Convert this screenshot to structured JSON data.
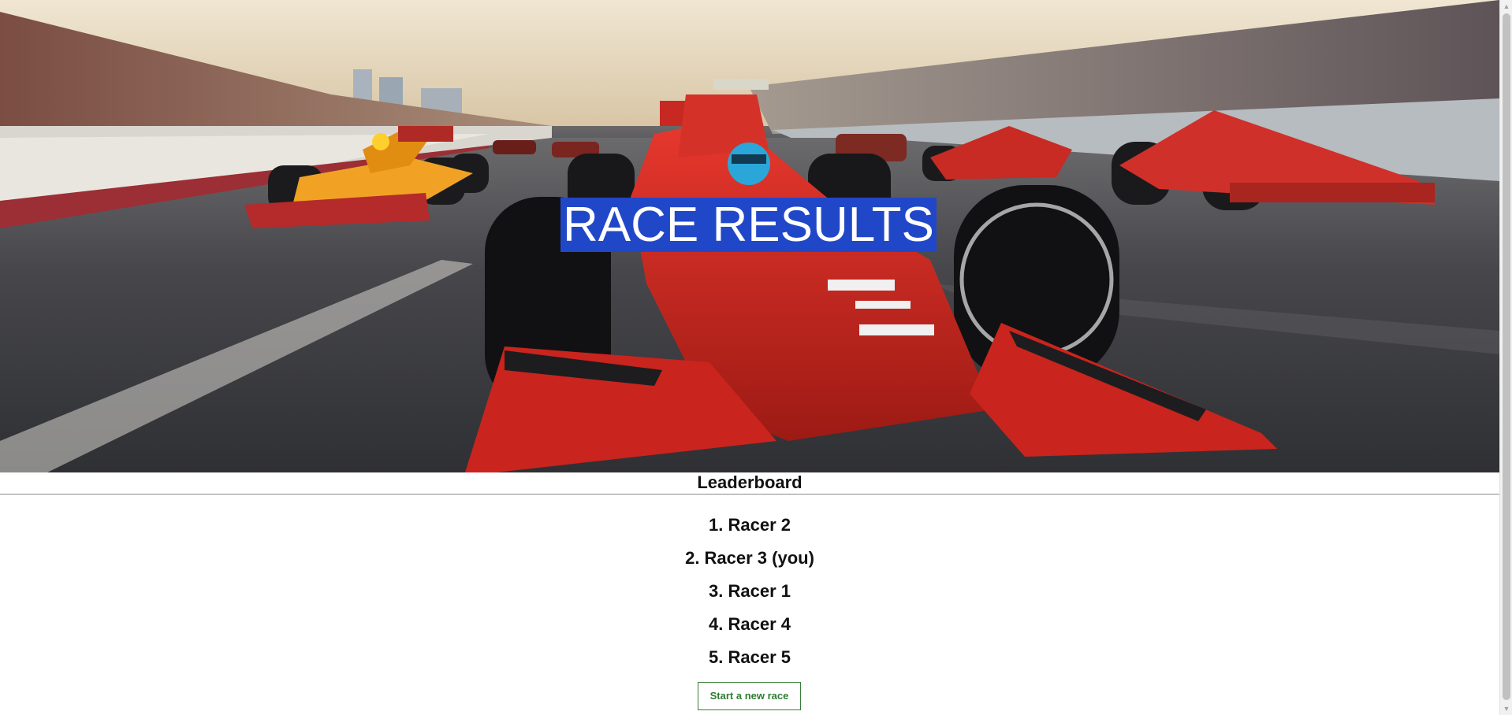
{
  "hero": {
    "title": "RACE RESULTS",
    "image_description_icon": "race-car-photo"
  },
  "leaderboard": {
    "title": "Leaderboard",
    "entries": [
      "1. Racer 2",
      "2. Racer 3 (you)",
      "3. Racer 1",
      "4. Racer 4",
      "5. Racer 5"
    ]
  },
  "actions": {
    "new_race_label": "Start a new race"
  },
  "colors": {
    "title_highlight": "#2147c9",
    "button_text": "#2e7d32",
    "button_border": "#3a7d3a"
  }
}
